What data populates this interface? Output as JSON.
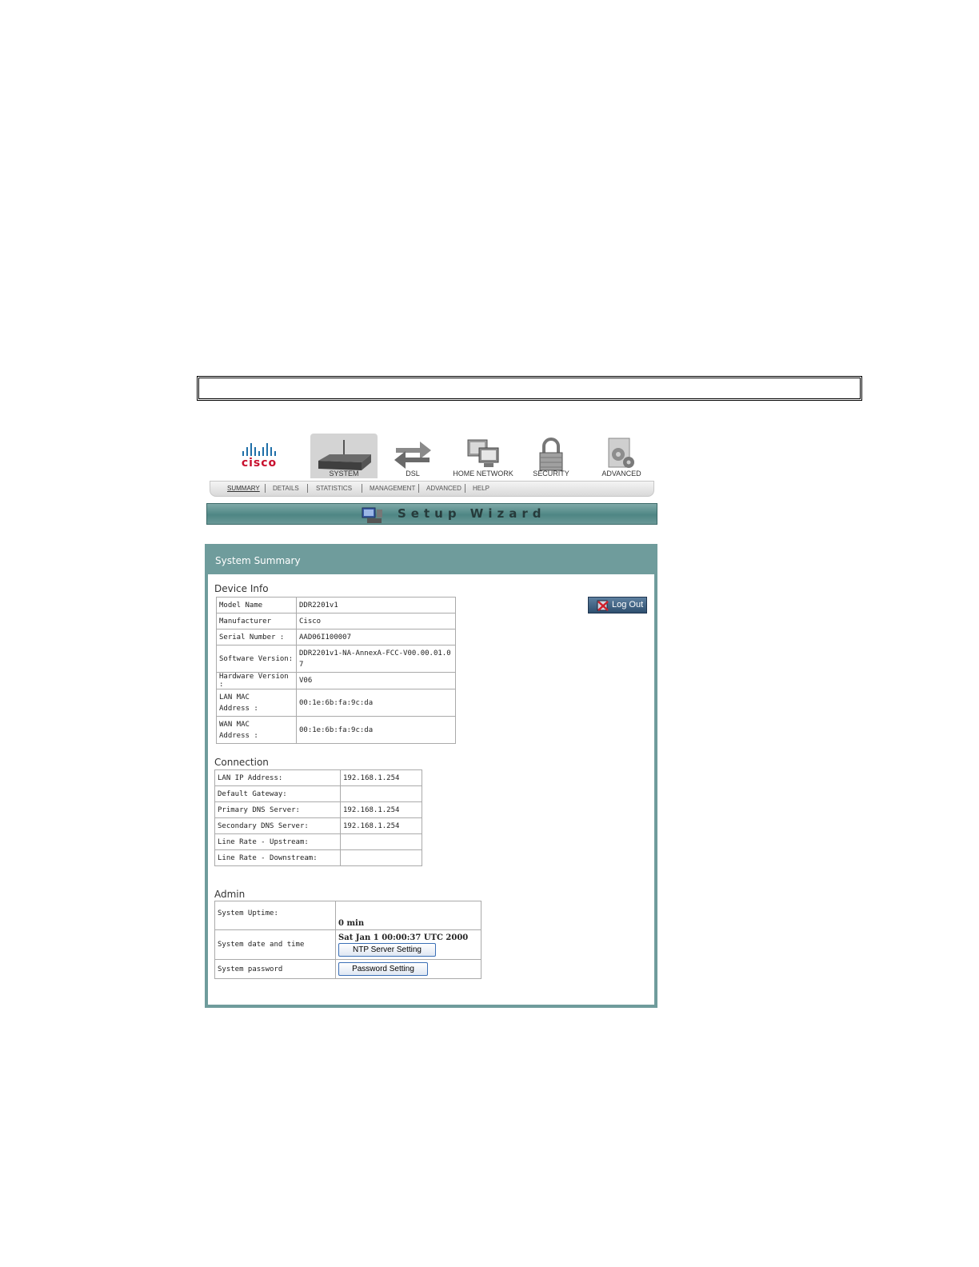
{
  "nav": {
    "logo": "cisco",
    "tabs": [
      {
        "label": "SYSTEM",
        "active": true,
        "icon": "router-icon"
      },
      {
        "label": "DSL",
        "active": false,
        "icon": "arrows-icon"
      },
      {
        "label": "HOME NETWORK",
        "active": false,
        "icon": "computers-icon"
      },
      {
        "label": "SECURITY",
        "active": false,
        "icon": "padlock-icon"
      },
      {
        "label": "ADVANCED",
        "active": false,
        "icon": "gears-icon"
      }
    ],
    "subtabs": [
      "SUMMARY",
      "DETAILS",
      "STATISTICS",
      "MANAGEMENT",
      "ADVANCED",
      "HELP"
    ],
    "active_subtab": "SUMMARY"
  },
  "wizard": {
    "label": "Setup Wizard"
  },
  "panel": {
    "title": "System Summary",
    "logout_label": "Log Out",
    "device_info": {
      "title": "Device Info",
      "rows": [
        {
          "label": "Model Name",
          "value": "DDR2201v1"
        },
        {
          "label": "Manufacturer",
          "value": "Cisco"
        },
        {
          "label": "Serial Number :",
          "value": "AAD06I100007"
        },
        {
          "label": "Software Version:",
          "value": "DDR2201v1-NA-AnnexA-FCC-V00.00.01.07"
        },
        {
          "label": "Hardware Version :",
          "value": "V06"
        },
        {
          "label": "LAN MAC Address :",
          "value": "00:1e:6b:fa:9c:da"
        },
        {
          "label": "WAN MAC Address :",
          "value": "00:1e:6b:fa:9c:da"
        }
      ]
    },
    "connection": {
      "title": "Connection",
      "rows": [
        {
          "label": "LAN IP Address:",
          "value": "192.168.1.254"
        },
        {
          "label": "Default Gateway:",
          "value": ""
        },
        {
          "label": "Primary DNS Server:",
          "value": "192.168.1.254"
        },
        {
          "label": "Secondary DNS Server:",
          "value": "192.168.1.254"
        },
        {
          "label": "Line Rate - Upstream:",
          "value": ""
        },
        {
          "label": "Line Rate - Downstream:",
          "value": ""
        }
      ]
    },
    "admin": {
      "title": "Admin",
      "uptime_label": "System Uptime:",
      "uptime_value": "0 min",
      "datetime_label": "System date and time",
      "datetime_value": "Sat Jan 1 00:00:37 UTC 2000",
      "ntp_button": "NTP Server Setting",
      "password_label": "System password",
      "password_button": "Password Setting"
    }
  }
}
